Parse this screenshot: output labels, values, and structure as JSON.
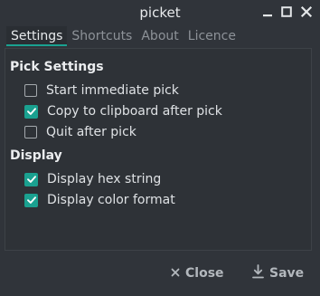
{
  "window": {
    "title": "picket"
  },
  "tabs": [
    {
      "label": "Settings",
      "active": true
    },
    {
      "label": "Shortcuts",
      "active": false
    },
    {
      "label": "About",
      "active": false
    },
    {
      "label": "Licence",
      "active": false
    }
  ],
  "pick_settings": {
    "title": "Pick Settings",
    "options": [
      {
        "label": "Start immediate pick",
        "checked": false
      },
      {
        "label": "Copy to clipboard after pick",
        "checked": true
      },
      {
        "label": "Quit after pick",
        "checked": false
      }
    ]
  },
  "display": {
    "title": "Display",
    "options": [
      {
        "label": "Display hex string",
        "checked": true
      },
      {
        "label": "Display color format",
        "checked": true
      }
    ]
  },
  "buttons": {
    "close_label": "Close",
    "save_label": "Save"
  },
  "colors": {
    "accent": "#1aa190",
    "background": "#30343a"
  }
}
